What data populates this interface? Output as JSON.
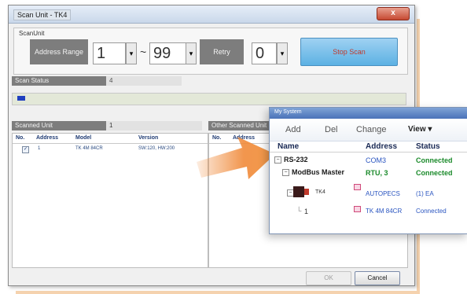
{
  "scan_window": {
    "title": "Scan Unit - TK4",
    "close_glyph": "x",
    "scan_unit_group_label": "ScanUnit",
    "address_range_label": "Address Range",
    "address_from": "1",
    "range_separator": "~",
    "address_to": "99",
    "retry_label": "Retry",
    "retry_value": "0",
    "stop_scan_label": "Stop Scan",
    "scan_status_label": "Scan Status",
    "scan_status_value": "4",
    "progress_fraction": 0.02,
    "scanned_unit_label": "Scanned Unit",
    "scanned_unit_count": "1",
    "other_scanned_label": "Other Scanned Unit",
    "scanned_table": {
      "headers": [
        "No.",
        "Address",
        "Model",
        "Version"
      ],
      "rows": [
        {
          "no": "1",
          "address": "",
          "model": "TK 4M 84CR",
          "version": "SW:120, HW:200",
          "checked": true
        }
      ]
    },
    "other_table": {
      "headers": [
        "No.",
        "Address"
      ]
    },
    "ok_label": "OK",
    "cancel_label": "Cancel"
  },
  "my_system": {
    "title": "My System",
    "toolbar": [
      "Add",
      "Del",
      "Change",
      "View ▾"
    ],
    "columns": [
      "Name",
      "Address",
      "Status"
    ],
    "rows": [
      {
        "name": "RS-232",
        "address": "COM3",
        "status": "Connected"
      },
      {
        "name": "ModBus Master",
        "address": "RTU, 3",
        "status": "Connected"
      },
      {
        "name": "TK4",
        "address": "AUTOPECS",
        "status": "(1) EA"
      },
      {
        "name": "1",
        "address": "TK 4M 84CR",
        "status": "Connected"
      }
    ]
  },
  "colors": {
    "accent_blue": "#5cb1e3",
    "connected_green": "#1a8a2a",
    "arrow_orange": "#f08a3a"
  }
}
